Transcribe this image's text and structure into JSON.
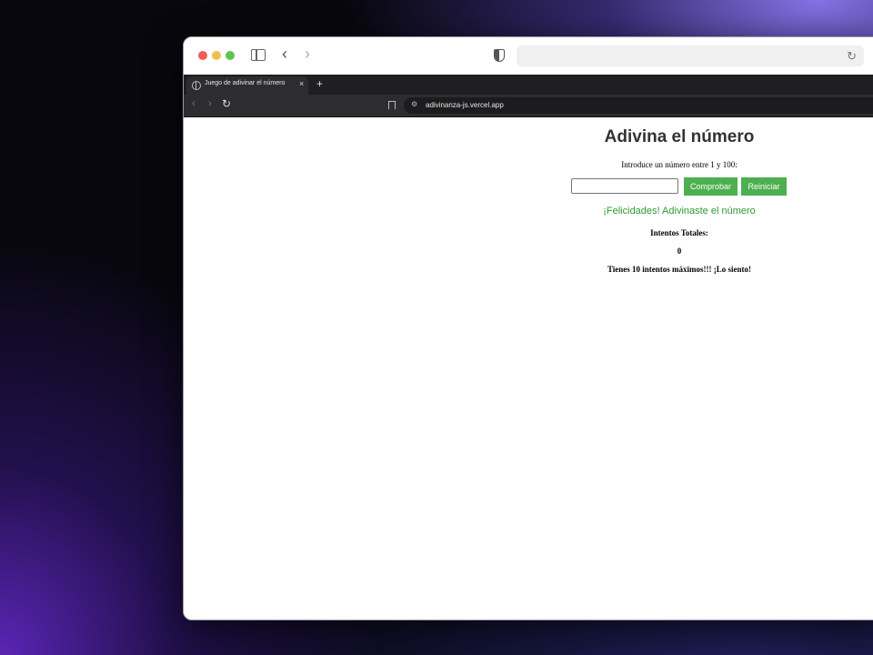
{
  "browser": {
    "tab_title": "Juego de adivinar el número",
    "tab_close_glyph": "×",
    "new_tab_glyph": "+",
    "url": "adivinanza-js.vercel.app"
  },
  "page": {
    "heading": "Adivina el número",
    "instructions": "Introduce un número entre 1 y 100:",
    "guess_value": "",
    "check_label": "Comprobar",
    "reset_label": "Reiniciar",
    "result_message": "¡Felicidades! Adivinaste el número",
    "attempts_label": "Intentos Totales:",
    "attempts_count": "0",
    "max_attempts_note": "Tienes 10 intentos máximos!!! ¡Lo siento!"
  },
  "colors": {
    "button_bg": "#4caf50",
    "success_text": "#2e9a32",
    "heading_text": "#333333"
  }
}
